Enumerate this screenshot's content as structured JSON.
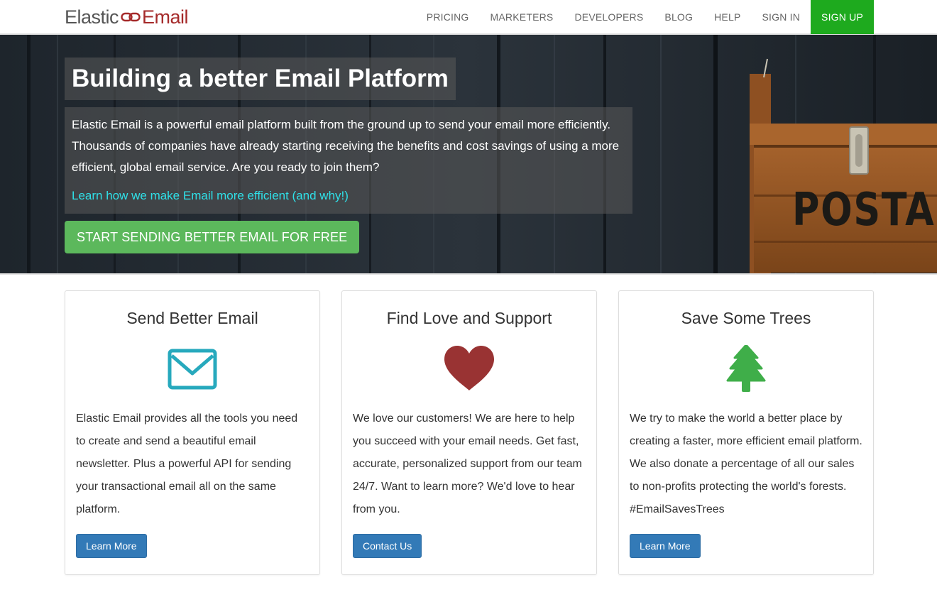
{
  "brand": {
    "part1": "Elastic",
    "part2": "Email"
  },
  "nav": {
    "items": [
      "PRICING",
      "MARKETERS",
      "DEVELOPERS",
      "BLOG",
      "HELP",
      "SIGN IN"
    ],
    "signup": "SIGN UP"
  },
  "hero": {
    "title": "Building a better Email Platform",
    "body": "Elastic Email is a powerful email platform built from the ground up to send your email more efficiently. Thousands of companies have already starting receiving the benefits and cost savings of using a more efficient, global email service. Are you ready to join them?",
    "link": "Learn how we make Email more efficient (and why!)",
    "cta": "START SENDING BETTER EMAIL FOR FREE",
    "sign_text": "POSTA"
  },
  "cards": [
    {
      "title": "Send Better Email",
      "icon": "envelope-icon",
      "text": "Elastic Email provides all the tools you need to create and send a beautiful email newsletter. Plus a powerful API for sending your transactional email all on the same platform.",
      "button": "Learn More"
    },
    {
      "title": "Find Love and Support",
      "icon": "heart-icon",
      "text": "We love our customers! We are here to help you succeed with your email needs. Get fast, accurate, personalized support from our team 24/7. Want to learn more? We'd love to hear from you.",
      "button": "Contact Us"
    },
    {
      "title": "Save Some Trees",
      "icon": "tree-icon",
      "text": "We try to make the world a better place by creating a faster, more efficient email platform. We also donate a percentage of all our sales to non-profits protecting the world's forests. #EmailSavesTrees",
      "button": "Learn More"
    }
  ],
  "colors": {
    "brand_red": "#a52a2a",
    "signup_green": "#1eaa1e",
    "cta_green": "#5cb85c",
    "button_blue": "#337ab7",
    "envelope_teal": "#27a9bd",
    "heart_red": "#993333",
    "tree_green": "#3fae49",
    "hero_link_cyan": "#2fe0e8"
  }
}
